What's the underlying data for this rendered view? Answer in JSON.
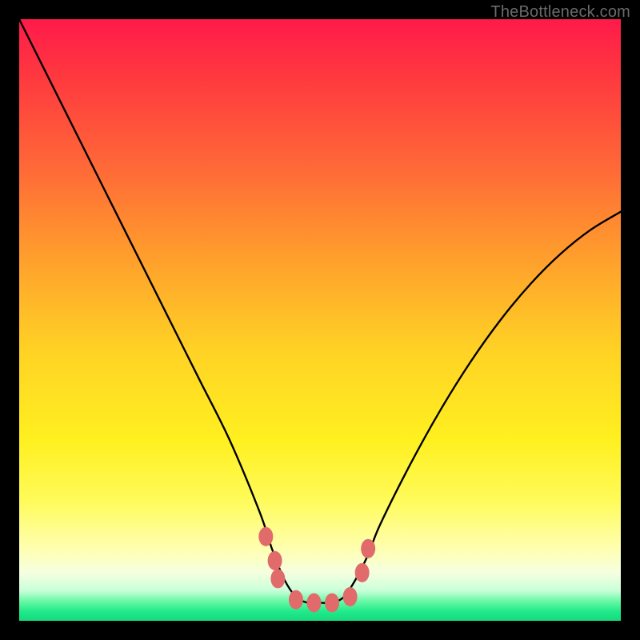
{
  "watermark": "TheBottleneck.com",
  "chart_data": {
    "type": "line",
    "title": "",
    "xlabel": "",
    "ylabel": "",
    "xlim": [
      0,
      100
    ],
    "ylim": [
      0,
      100
    ],
    "series": [
      {
        "name": "bottleneck-curve",
        "x": [
          0,
          5,
          10,
          15,
          20,
          25,
          30,
          35,
          40,
          42,
          44,
          46,
          48,
          50,
          52,
          54,
          56,
          58,
          60,
          65,
          70,
          75,
          80,
          85,
          90,
          95,
          100
        ],
        "y": [
          100,
          90,
          80,
          70,
          60,
          50,
          40,
          30,
          18,
          12,
          7,
          4,
          3,
          3,
          3,
          4,
          7,
          11,
          16,
          26,
          35,
          43,
          50,
          56,
          61,
          65,
          68
        ]
      }
    ],
    "markers": {
      "name": "highlight-dots",
      "color": "#e16a6a",
      "points": [
        {
          "x": 41,
          "y": 14
        },
        {
          "x": 42.5,
          "y": 10
        },
        {
          "x": 43,
          "y": 7
        },
        {
          "x": 46,
          "y": 3.5
        },
        {
          "x": 49,
          "y": 3
        },
        {
          "x": 52,
          "y": 3
        },
        {
          "x": 55,
          "y": 4
        },
        {
          "x": 57,
          "y": 8
        },
        {
          "x": 58,
          "y": 12
        }
      ]
    },
    "gradient_stops": [
      {
        "pos": 0,
        "color": "#ff1a4a"
      },
      {
        "pos": 55,
        "color": "#ffd225"
      },
      {
        "pos": 88,
        "color": "#ffffb0"
      },
      {
        "pos": 100,
        "color": "#17d97e"
      }
    ]
  }
}
